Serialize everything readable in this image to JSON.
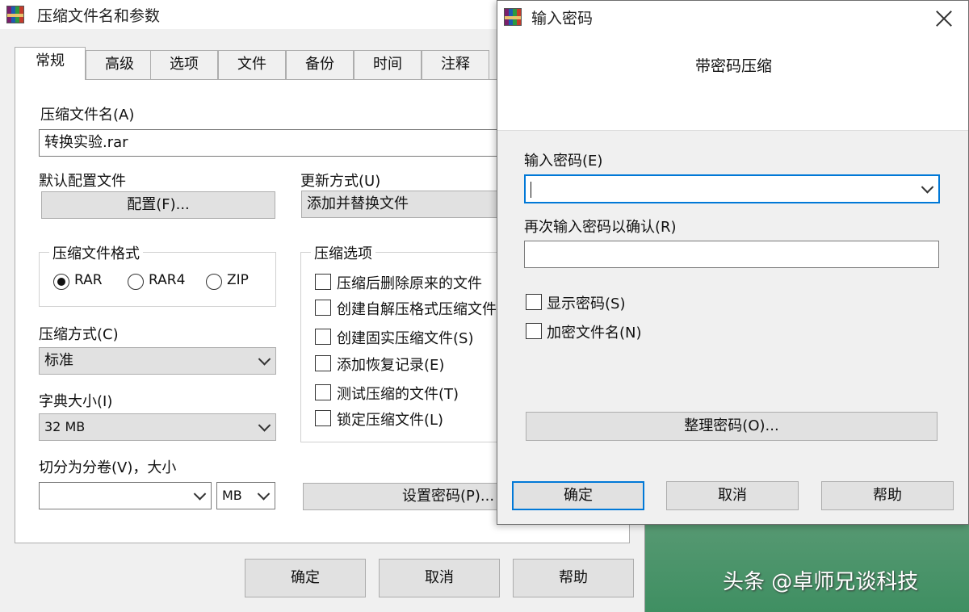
{
  "main_window": {
    "title": "压缩文件名和参数",
    "tabs": [
      {
        "label": "常规"
      },
      {
        "label": "高级"
      },
      {
        "label": "选项"
      },
      {
        "label": "文件"
      },
      {
        "label": "备份"
      },
      {
        "label": "时间"
      },
      {
        "label": "注释"
      }
    ],
    "archive_name_label": "压缩文件名(A)",
    "archive_name_value": "转换实验.rar",
    "default_profile_label": "默认配置文件",
    "profile_button": "配置(F)...",
    "update_mode_label": "更新方式(U)",
    "update_mode_value": "添加并替换文件",
    "format_group_title": "压缩文件格式",
    "formats": [
      {
        "label": "RAR",
        "checked": true
      },
      {
        "label": "RAR4",
        "checked": false
      },
      {
        "label": "ZIP",
        "checked": false
      }
    ],
    "method_label": "压缩方式(C)",
    "method_value": "标准",
    "dict_label": "字典大小(I)",
    "dict_value": "32 MB",
    "split_label": "切分为分卷(V)，大小",
    "split_value": "",
    "split_unit": "MB",
    "options_group_title": "压缩选项",
    "options": [
      {
        "label": "压缩后删除原来的文件",
        "checked": false
      },
      {
        "label": "创建自解压格式压缩文件",
        "checked": false
      },
      {
        "label": "创建固实压缩文件(S)",
        "checked": false
      },
      {
        "label": "添加恢复记录(E)",
        "checked": false
      },
      {
        "label": "测试压缩的文件(T)",
        "checked": false
      },
      {
        "label": "锁定压缩文件(L)",
        "checked": false
      }
    ],
    "set_password_button": "设置密码(P)...",
    "ok_button": "确定",
    "cancel_button": "取消",
    "help_button": "帮助"
  },
  "dialog": {
    "title": "输入密码",
    "heading": "带密码压缩",
    "password_label": "输入密码(E)",
    "password_value": "",
    "confirm_label": "再次输入密码以确认(R)",
    "confirm_value": "",
    "show_password_label": "显示密码(S)",
    "encrypt_names_label": "加密文件名(N)",
    "organize_button": "整理密码(O)...",
    "ok_button": "确定",
    "cancel_button": "取消",
    "help_button": "帮助"
  },
  "watermark": "头条 @卓师兄谈科技"
}
